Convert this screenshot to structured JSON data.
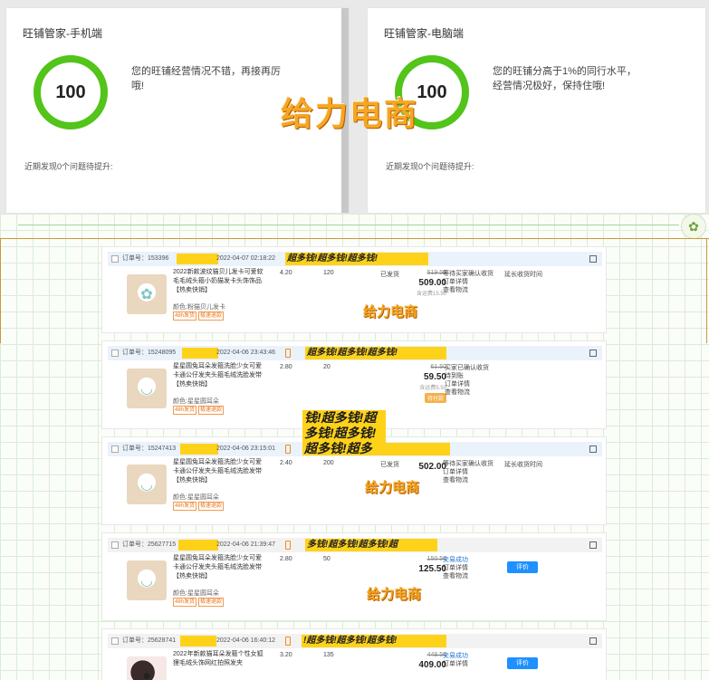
{
  "panels": [
    {
      "title": "旺铺管家-手机端",
      "score": "100",
      "description": "您的旺铺经营情况不错，再接再厉哦!",
      "issues": "近期发现0个问题待提升:"
    },
    {
      "title": "旺铺管家-电脑端",
      "score": "100",
      "description": "您的旺铺分高于1%的同行水平，经营情况极好，保持住哦!",
      "issues": "近期发现0个问题待提升:"
    }
  ],
  "watermark": "给力电商",
  "sticker_text": "钱!超多钱!超多钱!超多钱!超多钱!超多钱!超多钱!",
  "orders": [
    {
      "order_no": "订单号：153396",
      "time": "2022-04-07 02:18:22",
      "band": "超多钱!超多钱!超多钱!",
      "title": "2022新款波纹猫贝儿发卡可爱软毛毛绒头箍小奶猫发卡头饰饰品 【热卖快销】",
      "spec": "颜色:粉猫贝儿发卡",
      "tags": [
        "48h发货",
        "极速退款"
      ],
      "price": "4.20",
      "qty": "120",
      "state": "已发货",
      "orig_price": "519.50",
      "total": "509.00",
      "shipping": "含运费15.50",
      "actions": [
        "等待买家确认收货",
        "订单详情",
        "查看物流"
      ],
      "extend": "延长收货时间",
      "rate": ""
    },
    {
      "order_no": "订单号：15248095",
      "time": "2022-04-06 23:43:46",
      "band": "超多钱!超多钱!超多钱!",
      "title": "星星圆兔耳朵发箍洗脸少女可爱卡通公仔发夹头箍毛绒洗脸发带 【热卖快销】",
      "spec": "颜色:星星圆耳朵",
      "tags": [
        "48h发货",
        "极速退款"
      ],
      "price": "2.80",
      "qty": "20",
      "state": "",
      "orig_price": "61.50",
      "total": "59.50",
      "shipping": "含运费5.50",
      "pay_badge": "待付款",
      "actions": [
        "买家已确认收货",
        "待到账",
        "订单详情",
        "查看物流"
      ],
      "extend": "",
      "rate": ""
    },
    {
      "order_no": "订单号：15247413",
      "time": "2022-04-06 23:15:01",
      "band": "超多钱!超多钱!超",
      "title": "星星圆兔耳朵发箍洗脸少女可爱卡通公仔发夹头箍毛绒洗脸发带 【热卖快销】",
      "spec": "颜色:星星圆耳朵",
      "tags": [
        "48h发货",
        "极速退款"
      ],
      "price": "2.40",
      "qty": "200",
      "state": "已发货",
      "orig_price": "",
      "total": "502.00",
      "shipping": "",
      "actions": [
        "等待买家确认收货",
        "订单详情",
        "查看物流"
      ],
      "extend": "延长收货时间",
      "rate": ""
    },
    {
      "order_no": "订单号：25627715",
      "time": "2022-04-06 21:39:47",
      "band": "多钱!超多钱!超多钱!超",
      "title": "星星圆兔耳朵发箍洗脸少女可爱卡通公仔发夹头箍毛绒洗脸发带 【热卖快销】",
      "spec": "颜色:星星圆耳朵",
      "tags": [
        "48h发货",
        "极速退款"
      ],
      "price": "2.80",
      "qty": "50",
      "state": "",
      "orig_price": "150.50",
      "total": "125.50",
      "shipping": "",
      "actions": [
        "交易成功",
        "订单详情",
        "查看物流"
      ],
      "extend": "",
      "rate": "评价"
    },
    {
      "order_no": "订单号：25628741",
      "time": "2022-04-06 16:40:12",
      "band": "!超多钱!超多钱!超多钱!",
      "title": "2022年新款猫耳朵发箍个性女狐狸毛绒头饰网红拍照发夹",
      "spec": "",
      "tags": [],
      "price": "3.20",
      "qty": "135",
      "state": "",
      "orig_price": "449.50",
      "total": "409.00",
      "shipping": "",
      "actions": [
        "交易成功",
        "订单详情"
      ],
      "extend": "",
      "rate": "评价"
    }
  ]
}
